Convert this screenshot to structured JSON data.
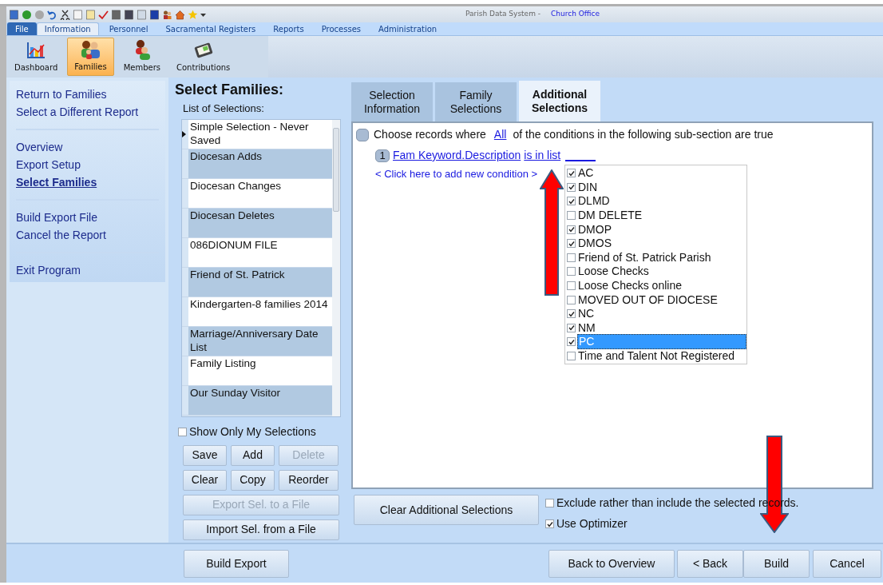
{
  "title_bar": {
    "app": "Parish Data System -",
    "office": "Church Office"
  },
  "menu_tabs": [
    {
      "label": "File",
      "kind": "file",
      "selected": false
    },
    {
      "label": "Information",
      "kind": "tab",
      "selected": true
    },
    {
      "label": "Personnel",
      "kind": "tab",
      "selected": false
    },
    {
      "label": "Sacramental Registers",
      "kind": "tab",
      "selected": false
    },
    {
      "label": "Reports",
      "kind": "tab",
      "selected": false
    },
    {
      "label": "Processes",
      "kind": "tab",
      "selected": false
    },
    {
      "label": "Administration",
      "kind": "tab",
      "selected": false
    }
  ],
  "ribbon": [
    {
      "label": "Dashboard",
      "kind": "chart",
      "selected": false
    },
    {
      "label": "Families",
      "kind": "family",
      "selected": true
    },
    {
      "label": "Members",
      "kind": "members",
      "selected": false
    },
    {
      "label": "Contributions",
      "kind": "contributions",
      "selected": false
    }
  ],
  "nav_groups": [
    [
      {
        "label": "Return to Families",
        "selected": false
      },
      {
        "label": "Select a Different Report",
        "selected": false
      }
    ],
    [
      {
        "label": "Overview",
        "selected": false
      },
      {
        "label": "Export Setup",
        "selected": false
      },
      {
        "label": "Select Families",
        "selected": true
      }
    ],
    [
      {
        "label": "Build Export File",
        "selected": false
      },
      {
        "label": "Cancel the Report",
        "selected": false
      }
    ],
    [
      {
        "label": "Exit Program",
        "selected": false
      }
    ]
  ],
  "selection_panel": {
    "title": "Select Families:",
    "list_label": "List of Selections:",
    "items": [
      {
        "label": "Simple Selection - Never Saved",
        "selected": true
      },
      {
        "label": "Diocesan Adds",
        "selected": false
      },
      {
        "label": "Diocesan Changes",
        "selected": false
      },
      {
        "label": "Diocesan Deletes",
        "selected": false
      },
      {
        "label": "086DIONUM FILE",
        "selected": false
      },
      {
        "label": "Friend of St. Patrick",
        "selected": false
      },
      {
        "label": "Kindergarten-8 families 2014",
        "selected": false
      },
      {
        "label": "Marriage/Anniversary Date List",
        "selected": false
      },
      {
        "label": "Family Listing",
        "selected": false
      },
      {
        "label": "Our Sunday Visitor",
        "selected": false
      }
    ],
    "show_only_mine": {
      "label": "Show Only My Selections",
      "checked": false
    },
    "button_rows": [
      [
        {
          "label": "Save",
          "disabled": false
        },
        {
          "label": "Add",
          "disabled": false
        },
        {
          "label": "Delete",
          "disabled": true
        }
      ],
      [
        {
          "label": "Clear",
          "disabled": false
        },
        {
          "label": "Copy",
          "disabled": false
        },
        {
          "label": "Reorder",
          "disabled": false
        }
      ],
      [
        {
          "label": "Export Sel. to a File",
          "disabled": true
        }
      ],
      [
        {
          "label": "Import  Sel. from a File",
          "disabled": false
        }
      ]
    ]
  },
  "tabs": [
    {
      "label": "Selection Information",
      "selected": false
    },
    {
      "label": "Family Selections",
      "selected": false
    },
    {
      "label": "Additional Selections",
      "selected": true
    }
  ],
  "criteria": {
    "prefix": "Choose records where",
    "quantifier": "All",
    "suffix": "of the conditions in the following sub-section are true",
    "condition": {
      "number": "1",
      "field": "Fam Keyword.Description",
      "operator": "is in list"
    },
    "add_link": "< Click here to add new condition >"
  },
  "keyword_list": [
    {
      "label": "AC",
      "checked": true,
      "selected": false
    },
    {
      "label": "DIN",
      "checked": true,
      "selected": false
    },
    {
      "label": "DLMD",
      "checked": true,
      "selected": false
    },
    {
      "label": "DM DELETE",
      "checked": false,
      "selected": false
    },
    {
      "label": "DMOP",
      "checked": true,
      "selected": false
    },
    {
      "label": "DMOS",
      "checked": true,
      "selected": false
    },
    {
      "label": "Friend of St. Patrick Parish",
      "checked": false,
      "selected": false
    },
    {
      "label": "Loose Checks",
      "checked": false,
      "selected": false
    },
    {
      "label": "Loose Checks online",
      "checked": false,
      "selected": false
    },
    {
      "label": "MOVED OUT OF DIOCESE",
      "checked": false,
      "selected": false
    },
    {
      "label": "NC",
      "checked": true,
      "selected": false
    },
    {
      "label": "NM",
      "checked": true,
      "selected": false
    },
    {
      "label": "PC",
      "checked": true,
      "selected": true
    },
    {
      "label": "Time and Talent Not Registered",
      "checked": false,
      "selected": false
    }
  ],
  "clear_button": "Clear Additional Selections",
  "options": [
    {
      "label": "Exclude rather than include the selected records.",
      "checked": false
    },
    {
      "label": "Use Optimizer",
      "checked": true
    }
  ],
  "footer": {
    "left": "Build Export",
    "right": [
      "Back to Overview",
      "< Back",
      "Build",
      "Cancel"
    ]
  }
}
